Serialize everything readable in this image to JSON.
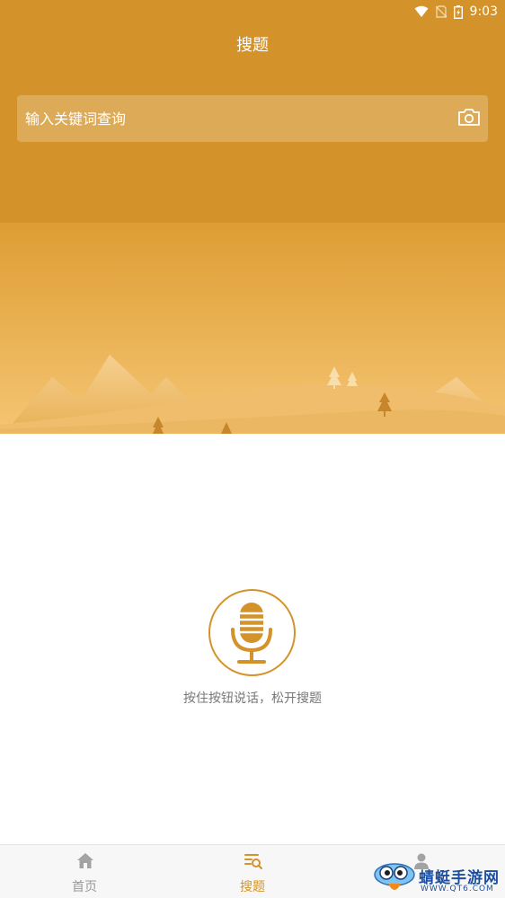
{
  "status_bar": {
    "time": "9:03"
  },
  "header": {
    "title": "搜题"
  },
  "search": {
    "placeholder": "输入关键词查询"
  },
  "voice": {
    "hint": "按住按钮说话，松开搜题"
  },
  "tabs": [
    {
      "label": "首页",
      "icon": "home-icon",
      "active": false
    },
    {
      "label": "搜题",
      "icon": "search-list-icon",
      "active": true
    }
  ],
  "watermark": {
    "text": "蜻蜓手游网",
    "sub": "WWW.QT6.COM"
  },
  "colors": {
    "accent": "#d4932a",
    "hint_text": "#777777",
    "tab_inactive": "#999999",
    "watermark": "#1d4fa1"
  }
}
